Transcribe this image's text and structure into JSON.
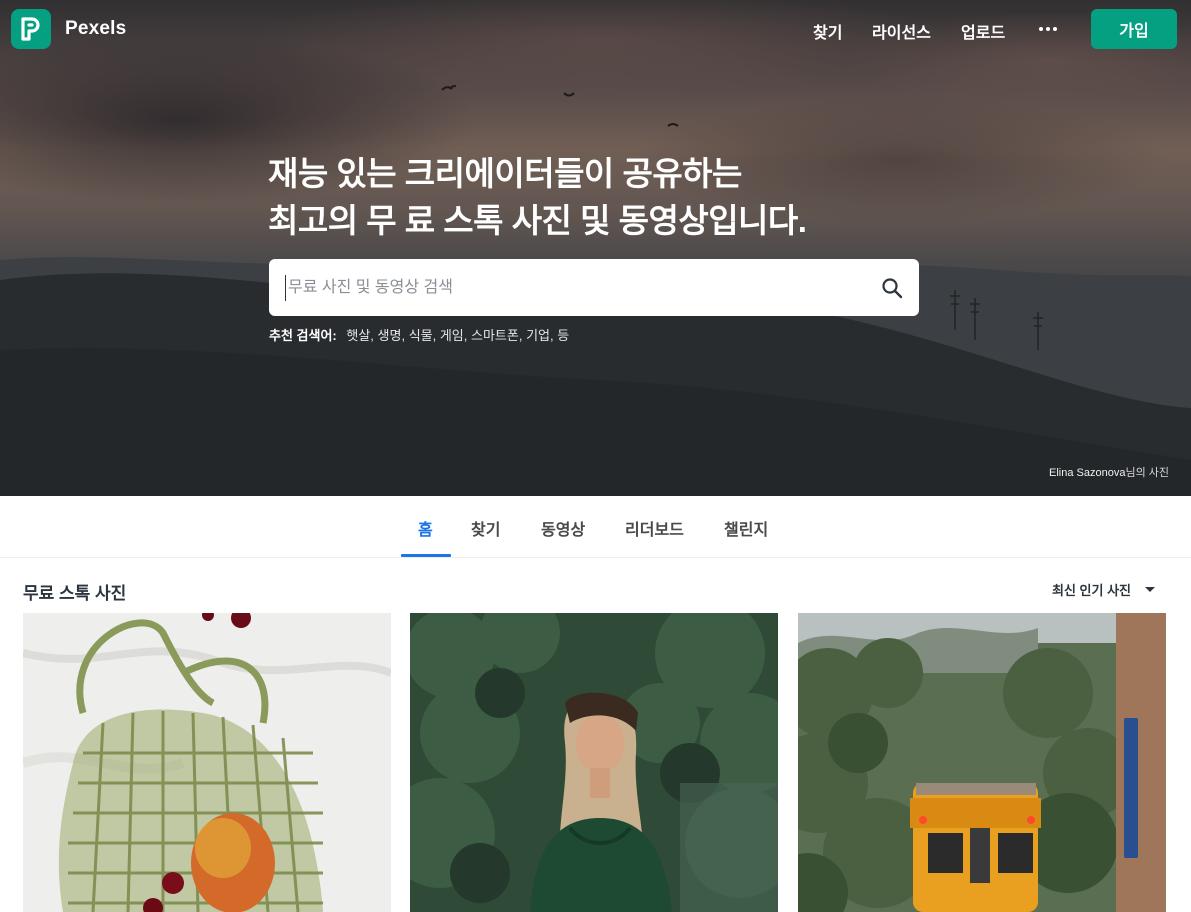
{
  "brand": {
    "name": "Pexels",
    "logo_letter": "P"
  },
  "nav": {
    "explore": "찾기",
    "license": "라이선스",
    "upload": "업로드",
    "more_icon": "more-dots-icon",
    "join": "가입"
  },
  "hero": {
    "title_line1": "재능 있는 크리에이터들이 공유하는",
    "title_line2": "최고의 무 료 스톡 사진 및 동영상입니다.",
    "search_placeholder": "무료 사진 및 동영상 검색",
    "search_value": "",
    "suggest_label": "추천 검색어:",
    "suggestions": [
      "햇살",
      "생명",
      "식물",
      "게임",
      "스마트폰",
      "기업",
      "등"
    ],
    "credit_name": "Elina Sazonova",
    "credit_suffix": "님의 사진"
  },
  "tabs": [
    {
      "label": "홈",
      "active": true
    },
    {
      "label": "찾기",
      "active": false
    },
    {
      "label": "동영상",
      "active": false
    },
    {
      "label": "리더보드",
      "active": false
    },
    {
      "label": "챌린지",
      "active": false
    }
  ],
  "section": {
    "title": "무료 스톡 사진",
    "sort_label": "최신 인기 사진"
  },
  "photos": [
    {
      "subject": "mango-in-mesh-bag"
    },
    {
      "subject": "woman-in-green-dress"
    },
    {
      "subject": "yellow-train-in-forest"
    }
  ],
  "colors": {
    "brand": "#05a081",
    "active_tab": "#1a73e8",
    "text": "#2c343e"
  }
}
